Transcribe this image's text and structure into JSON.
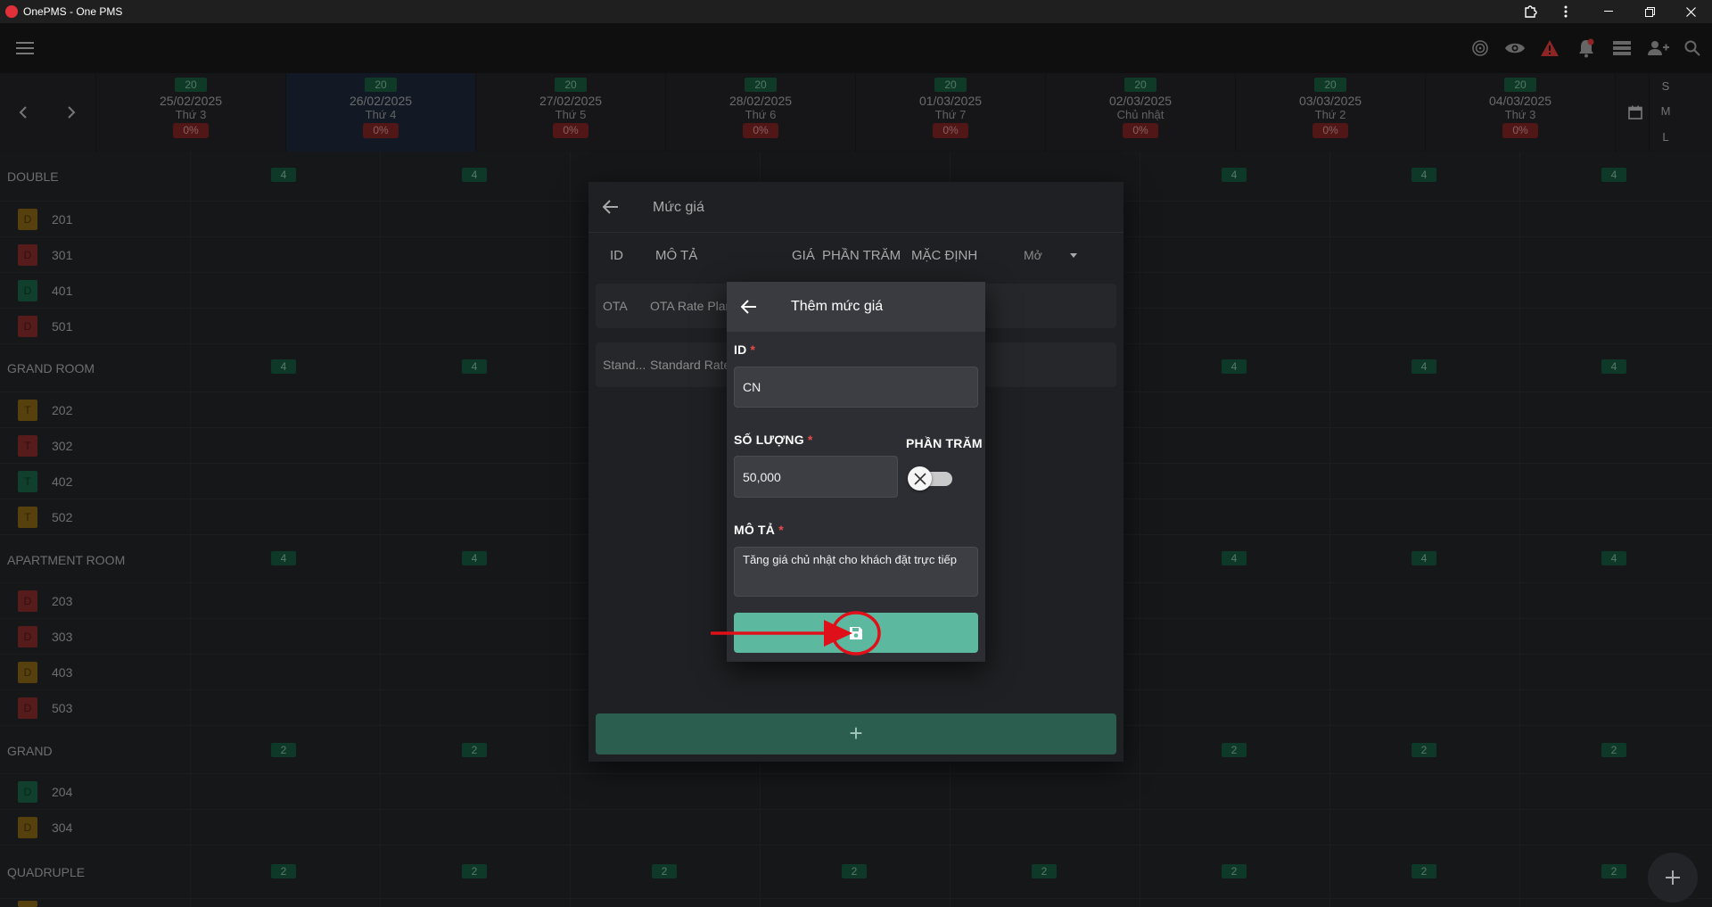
{
  "window": {
    "title": "OnePMS - One PMS",
    "controls": [
      "extensions-icon",
      "menu-dots-icon",
      "minimize-icon",
      "restore-icon",
      "close-icon"
    ]
  },
  "appbar": {
    "icons": [
      "hamburger-icon",
      "fingerprint-icon",
      "eye-icon",
      "warning-icon",
      "bell-icon",
      "list-icon",
      "add-user-icon",
      "search-icon"
    ]
  },
  "calendar": {
    "dates": [
      {
        "count": "20",
        "date": "25/02/2025",
        "day": "Thứ 3",
        "occupancy": "0%"
      },
      {
        "count": "20",
        "date": "26/02/2025",
        "day": "Thứ 4",
        "occupancy": "0%",
        "active": true
      },
      {
        "count": "20",
        "date": "27/02/2025",
        "day": "Thứ 5",
        "occupancy": "0%"
      },
      {
        "count": "20",
        "date": "28/02/2025",
        "day": "Thứ 6",
        "occupancy": "0%"
      },
      {
        "count": "20",
        "date": "01/03/2025",
        "day": "Thứ 7",
        "occupancy": "0%"
      },
      {
        "count": "20",
        "date": "02/03/2025",
        "day": "Chủ nhật",
        "occupancy": "0%"
      },
      {
        "count": "20",
        "date": "03/03/2025",
        "day": "Thứ 2",
        "occupancy": "0%"
      },
      {
        "count": "20",
        "date": "04/03/2025",
        "day": "Thứ 3",
        "occupancy": "0%"
      }
    ],
    "size_options": [
      "S",
      "M",
      "L"
    ]
  },
  "room_types": [
    {
      "name": "DOUBLE",
      "available": "4",
      "rooms": [
        {
          "code": "D",
          "number": "201",
          "color": "#a07a1c"
        },
        {
          "code": "D",
          "number": "301",
          "color": "#a33535"
        },
        {
          "code": "D",
          "number": "401",
          "color": "#1f7a55"
        },
        {
          "code": "D",
          "number": "501",
          "color": "#a33535"
        }
      ]
    },
    {
      "name": "GRAND ROOM",
      "available": "4",
      "rooms": [
        {
          "code": "T",
          "number": "202",
          "color": "#a07a1c"
        },
        {
          "code": "T",
          "number": "302",
          "color": "#a33535"
        },
        {
          "code": "T",
          "number": "402",
          "color": "#1f7a55"
        },
        {
          "code": "T",
          "number": "502",
          "color": "#a07a1c"
        }
      ]
    },
    {
      "name": "APARTMENT ROOM",
      "available": "4",
      "rooms": [
        {
          "code": "D",
          "number": "203",
          "color": "#a33535"
        },
        {
          "code": "D",
          "number": "303",
          "color": "#a33535"
        },
        {
          "code": "D",
          "number": "403",
          "color": "#a07a1c"
        },
        {
          "code": "D",
          "number": "503",
          "color": "#a33535"
        }
      ]
    },
    {
      "name": "GRAND",
      "available": "2",
      "rooms": [
        {
          "code": "D",
          "number": "204",
          "color": "#1f7a55"
        },
        {
          "code": "D",
          "number": "304",
          "color": "#a07a1c"
        }
      ]
    },
    {
      "name": "QUADRUPLE",
      "available": "2",
      "rooms": []
    }
  ],
  "rate_dialog": {
    "title": "Mức giá",
    "headers": {
      "id": "ID",
      "description": "MÔ TẢ",
      "price": "GIÁ",
      "percent": "PHẦN TRĂM",
      "default": "MẶC ĐỊNH",
      "filter": "Mở"
    },
    "rows": [
      {
        "id": "OTA",
        "description": "OTA Rate Plan"
      },
      {
        "id": "Stand...",
        "description": "Standard Rate"
      }
    ],
    "add_label": "+"
  },
  "add_rate_dialog": {
    "title": "Thêm mức giá",
    "id_label": "ID",
    "id_value": "CN",
    "amount_label": "SỐ LƯỢNG",
    "amount_value": "50,000",
    "percent_label": "PHẦN TRĂM",
    "percent_toggle": false,
    "desc_label": "MÔ TẢ",
    "desc_value": "Tăng giá chủ nhật cho khách đặt trực tiếp",
    "required_mark": "*",
    "save_icon": "save-icon"
  },
  "colors": {
    "accent": "#5cb9a0",
    "annotation": "#e0101a"
  }
}
